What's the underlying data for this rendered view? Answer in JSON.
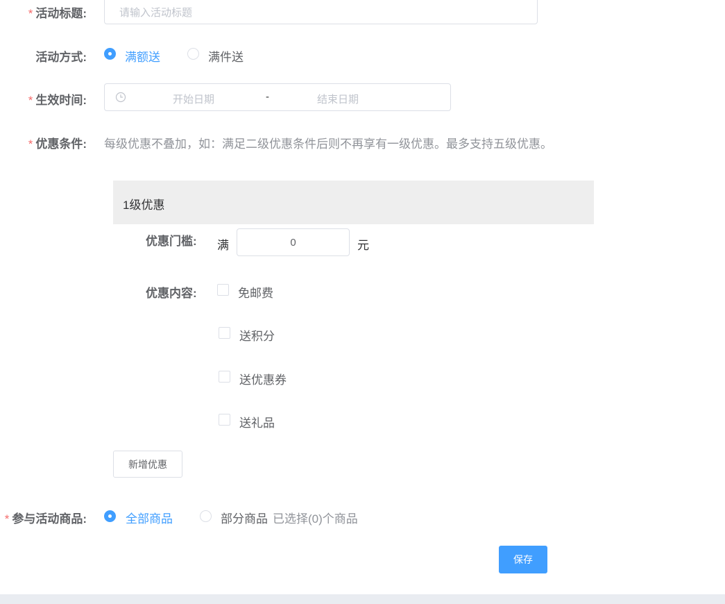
{
  "form": {
    "title": {
      "required_mark": "*",
      "label": "活动标题:",
      "placeholder": "请输入活动标题"
    },
    "method": {
      "label": "活动方式:",
      "options": [
        "满额送",
        "满件送"
      ],
      "selected": "满额送"
    },
    "effective_time": {
      "required_mark": "*",
      "label": "生效时间:",
      "start_placeholder": "开始日期",
      "separator": "-",
      "end_placeholder": "结束日期",
      "icon": "clock-icon"
    },
    "conditions": {
      "required_mark": "*",
      "label": "优惠条件:",
      "hint": "每级优惠不叠加，如：满足二级优惠条件后则不再享有一级优惠。最多支持五级优惠。"
    },
    "tier": {
      "header": "1级优惠",
      "threshold_label": "优惠门槛:",
      "threshold_prefix": "满",
      "threshold_value": "0",
      "threshold_suffix": "元",
      "content_label": "优惠内容:",
      "content_options": [
        "免邮费",
        "送积分",
        "送优惠券",
        "送礼品"
      ]
    },
    "add_tier_button": "新增优惠",
    "products": {
      "required_mark": "*",
      "label": "参与活动商品:",
      "options": [
        "全部商品",
        "部分商品"
      ],
      "selected": "全部商品",
      "selected_count_text": "已选择(0)个商品"
    },
    "save_button": "保存"
  },
  "colors": {
    "primary": "#409eff",
    "required": "#f56c6c",
    "tier_header_bg": "#eeeeee",
    "footer_bar": "#e9ecf1"
  }
}
